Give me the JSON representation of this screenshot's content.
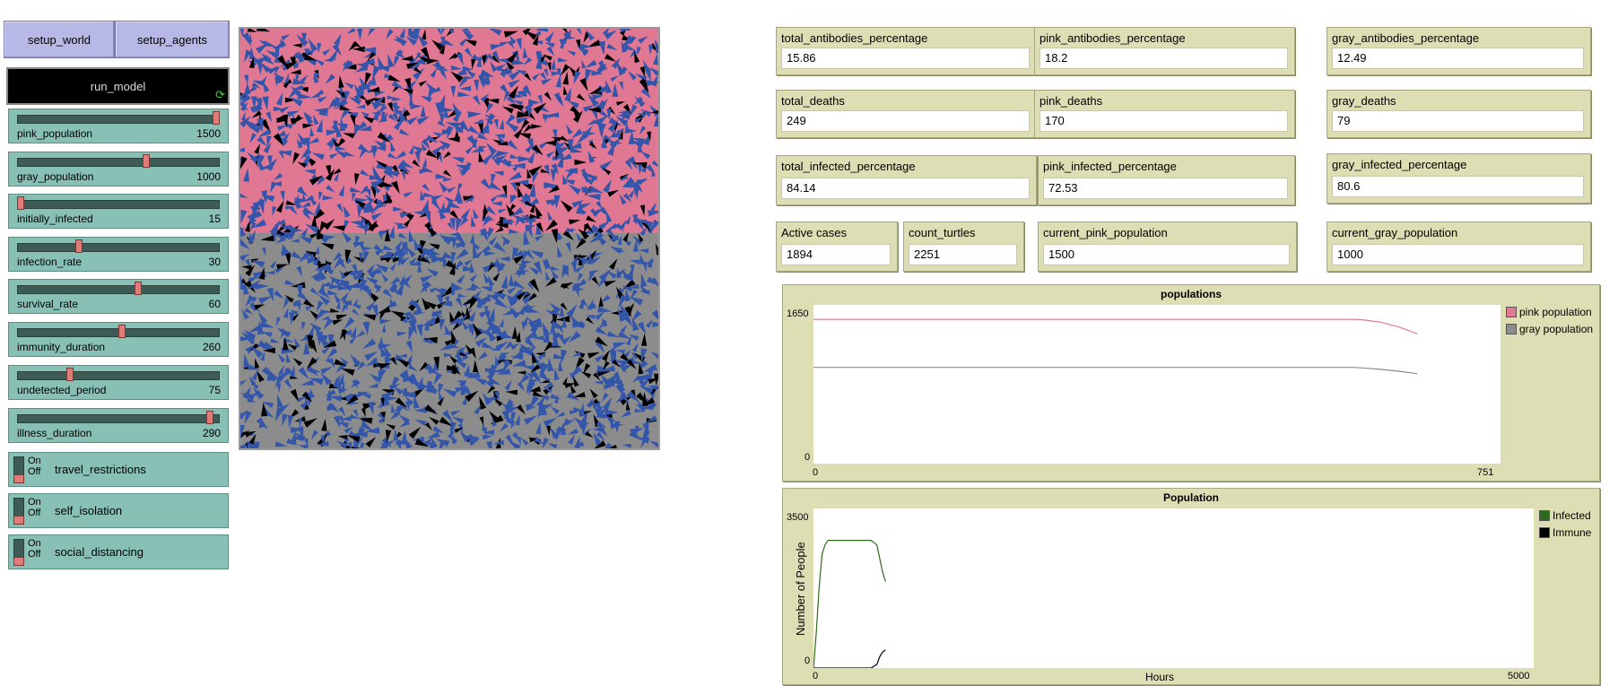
{
  "buttons": {
    "setup_world": "setup_world",
    "setup_agents": "setup_agents",
    "run_model": "run_model",
    "run_model_icon": "forever-arrows-icon"
  },
  "sliders": [
    {
      "label": "pink_population",
      "value": "1500",
      "fraction": 1.0
    },
    {
      "label": "gray_population",
      "value": "1000",
      "fraction": 0.64
    },
    {
      "label": "initially_infected",
      "value": "15",
      "fraction": 0.0
    },
    {
      "label": "infection_rate",
      "value": "30",
      "fraction": 0.3
    },
    {
      "label": "survival_rate",
      "value": "60",
      "fraction": 0.6
    },
    {
      "label": "immunity_duration",
      "value": "260",
      "fraction": 0.52
    },
    {
      "label": "undetected_period",
      "value": "75",
      "fraction": 0.25
    },
    {
      "label": "illness_duration",
      "value": "290",
      "fraction": 0.97
    }
  ],
  "switches": [
    {
      "name": "travel_restrictions",
      "on": "On",
      "off": "Off",
      "state": "off"
    },
    {
      "name": "self_isolation",
      "on": "On",
      "off": "Off",
      "state": "off"
    },
    {
      "name": "social_distancing",
      "on": "On",
      "off": "Off",
      "state": "off"
    }
  ],
  "world": {
    "top_color": "#e07893",
    "bottom_color": "#8c8c8c",
    "agent_color": "#3355aa",
    "dead_color": "#000000"
  },
  "monitors": [
    {
      "label": "total_antibodies_percentage",
      "value": "15.86"
    },
    {
      "label": "pink_antibodies_percentage",
      "value": "18.2"
    },
    {
      "label": "gray_antibodies_percentage",
      "value": "12.49"
    },
    {
      "label": "total_deaths",
      "value": "249"
    },
    {
      "label": "pink_deaths",
      "value": "170"
    },
    {
      "label": "gray_deaths",
      "value": "79"
    },
    {
      "label": "total_infected_percentage",
      "value": "84.14"
    },
    {
      "label": "pink_infected_percentage",
      "value": "72.53"
    },
    {
      "label": "gray_infected_percentage",
      "value": "80.6"
    },
    {
      "label": "Active cases",
      "value": "1894"
    },
    {
      "label": "count_turtles",
      "value": "2251"
    },
    {
      "label": "current_pink_population",
      "value": "1500"
    },
    {
      "label": "current_gray_population",
      "value": "1000"
    }
  ],
  "chart_data": [
    {
      "type": "line",
      "title": "populations",
      "xlabel": "",
      "ylabel": "",
      "xlim": [
        0,
        751
      ],
      "ylim": [
        0,
        1650
      ],
      "x_ticks": [
        "0",
        "751"
      ],
      "y_ticks": [
        "0",
        "1650"
      ],
      "series": [
        {
          "name": "pink population",
          "color": "#e07893",
          "x": [
            0,
            100,
            200,
            300,
            400,
            500,
            590,
            600,
            620,
            640,
            660
          ],
          "y": [
            1500,
            1500,
            1500,
            1500,
            1500,
            1500,
            1500,
            1495,
            1470,
            1420,
            1350
          ]
        },
        {
          "name": "gray population",
          "color": "#8c8c8c",
          "x": [
            0,
            100,
            200,
            300,
            400,
            500,
            590,
            600,
            620,
            640,
            660
          ],
          "y": [
            1000,
            1000,
            1000,
            1000,
            1000,
            1000,
            1000,
            995,
            980,
            960,
            935
          ]
        }
      ]
    },
    {
      "type": "line",
      "title": "Population",
      "xlabel": "Hours",
      "ylabel": "Number of People",
      "xlim": [
        0,
        5000
      ],
      "ylim": [
        0,
        3500
      ],
      "x_ticks": [
        "0",
        "5000"
      ],
      "y_ticks": [
        "0",
        "3500"
      ],
      "series": [
        {
          "name": "Infected",
          "color": "#2e6b1f",
          "x": [
            0,
            20,
            40,
            60,
            80,
            100,
            150,
            200,
            300,
            400,
            440,
            460,
            480,
            500
          ],
          "y": [
            0,
            800,
            1800,
            2500,
            2700,
            2800,
            2800,
            2800,
            2800,
            2800,
            2700,
            2400,
            2100,
            1900
          ]
        },
        {
          "name": "Immune",
          "color": "#000000",
          "x": [
            0,
            100,
            200,
            300,
            400,
            440,
            460,
            480,
            500
          ],
          "y": [
            0,
            0,
            0,
            0,
            0,
            80,
            250,
            350,
            400
          ]
        }
      ]
    }
  ]
}
